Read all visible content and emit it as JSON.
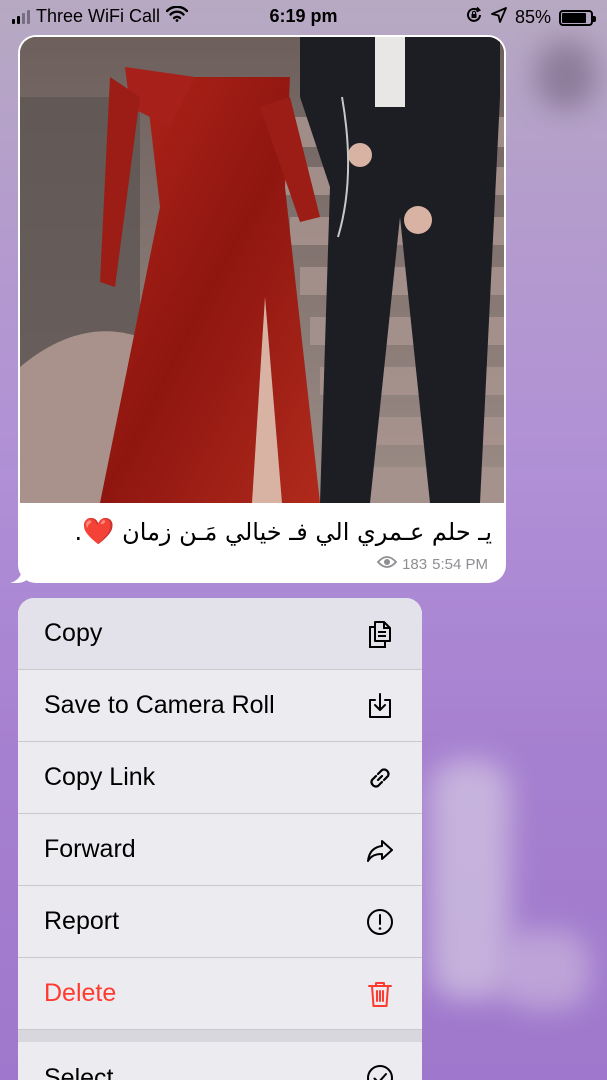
{
  "status_bar": {
    "carrier": "Three WiFi Call",
    "time": "6:19 pm",
    "battery": "85%",
    "battery_level": 0.85,
    "icons": [
      "signal-icon",
      "wifi-icon",
      "screen-lock-icon",
      "location-icon",
      "battery-icon"
    ]
  },
  "message": {
    "caption": "يـ حلم عـمري الي فـ خيالي مَـن زمان",
    "caption_emoji": "❤️",
    "caption_end": ".",
    "views": "183",
    "time": "5:54 PM",
    "photo_icon": "photo-image"
  },
  "menu": {
    "items": [
      {
        "label": "Copy",
        "icon": "copy-icon"
      },
      {
        "label": "Save to Camera Roll",
        "icon": "save-icon"
      },
      {
        "label": "Copy Link",
        "icon": "link-icon"
      },
      {
        "label": "Forward",
        "icon": "forward-icon"
      },
      {
        "label": "Report",
        "icon": "report-icon"
      },
      {
        "label": "Delete",
        "icon": "trash-icon"
      },
      {
        "label": "Select",
        "icon": "check-circle-icon"
      }
    ],
    "danger_color": "#ff3b30"
  },
  "colors": {
    "background": "#b08fd6",
    "bubble": "#ffffff",
    "menu": "#ececf0"
  }
}
